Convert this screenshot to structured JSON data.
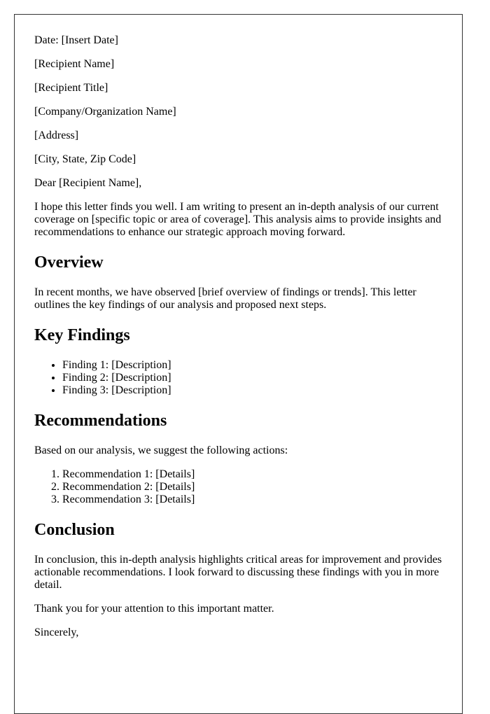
{
  "letter": {
    "date_line": "Date: [Insert Date]",
    "recipient_name": "[Recipient Name]",
    "recipient_title": "[Recipient Title]",
    "company": "[Company/Organization Name]",
    "address": "[Address]",
    "city_state_zip": "[City, State, Zip Code]",
    "salutation": "Dear [Recipient Name],",
    "intro": "I hope this letter finds you well. I am writing to present an in-depth analysis of our current coverage on [specific topic or area of coverage]. This analysis aims to provide insights and recommendations to enhance our strategic approach moving forward.",
    "sections": {
      "overview": {
        "heading": "Overview",
        "body": "In recent months, we have observed [brief overview of findings or trends]. This letter outlines the key findings of our analysis and proposed next steps."
      },
      "key_findings": {
        "heading": "Key Findings",
        "items": [
          "Finding 1: [Description]",
          "Finding 2: [Description]",
          "Finding 3: [Description]"
        ]
      },
      "recommendations": {
        "heading": "Recommendations",
        "lead": "Based on our analysis, we suggest the following actions:",
        "items": [
          "Recommendation 1: [Details]",
          "Recommendation 2: [Details]",
          "Recommendation 3: [Details]"
        ]
      },
      "conclusion": {
        "heading": "Conclusion",
        "body": "In conclusion, this in-depth analysis highlights critical areas for improvement and provides actionable recommendations. I look forward to discussing these findings with you in more detail."
      }
    },
    "thanks": "Thank you for your attention to this important matter.",
    "closing": "Sincerely,"
  }
}
